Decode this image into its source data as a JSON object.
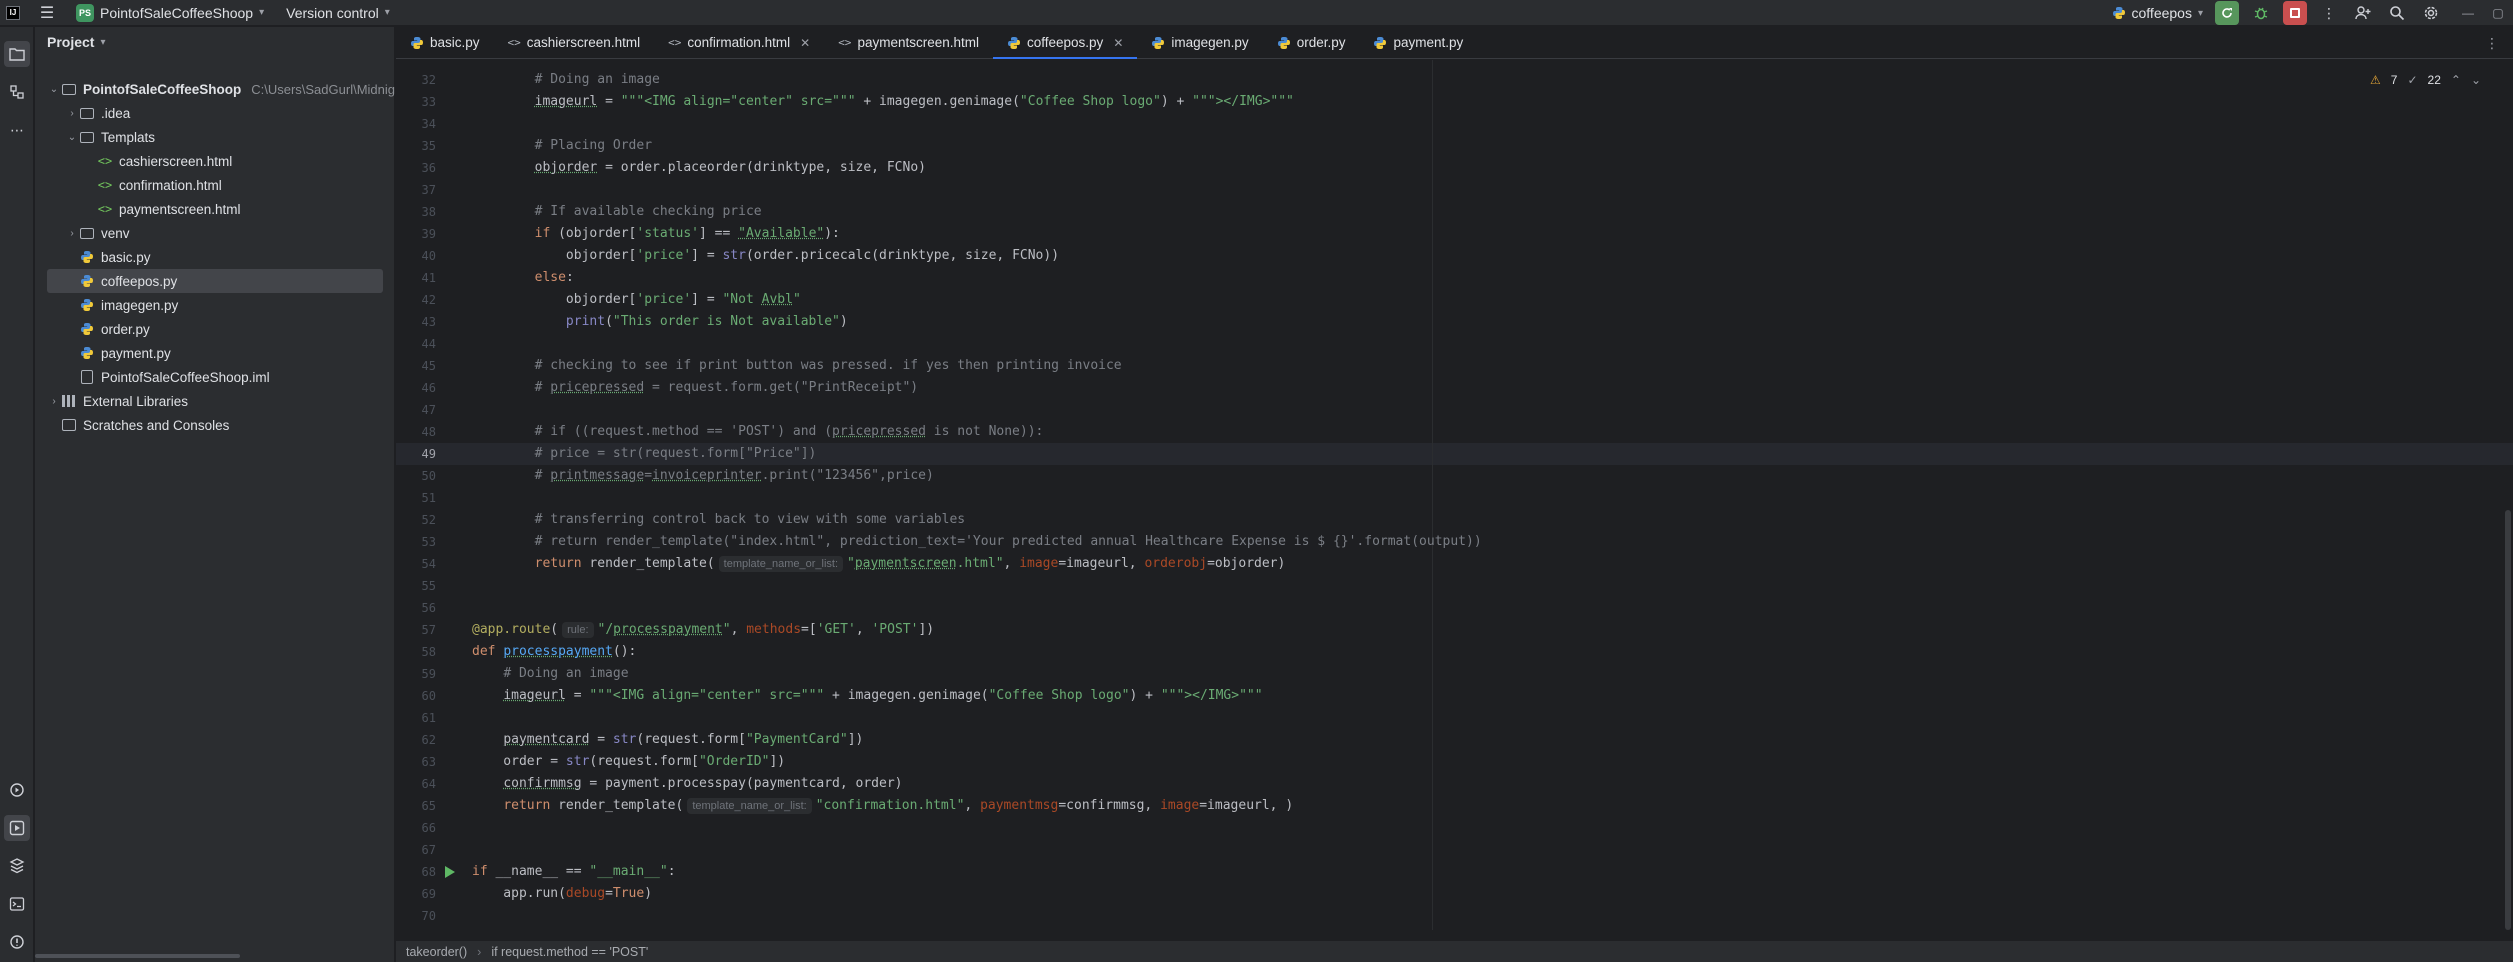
{
  "titlebar": {
    "logo_text": "IJ",
    "project_badge": "PS",
    "project_name": "PointofSaleCoffeeShoop",
    "version_control": "Version control",
    "run_config": "coffeepos"
  },
  "project_panel": {
    "title": "Project",
    "tree": [
      {
        "label": "PointofSaleCoffeeShoop",
        "path": "C:\\Users\\SadGurl\\Midnig",
        "type": "folder",
        "depth": 0,
        "expanded": true
      },
      {
        "label": ".idea",
        "type": "folder",
        "depth": 1,
        "expanded": false
      },
      {
        "label": "Templats",
        "type": "folder",
        "depth": 1,
        "expanded": true
      },
      {
        "label": "cashierscreen.html",
        "type": "html",
        "depth": 2
      },
      {
        "label": "confirmation.html",
        "type": "html",
        "depth": 2
      },
      {
        "label": "paymentscreen.html",
        "type": "html",
        "depth": 2
      },
      {
        "label": "venv",
        "type": "folder",
        "depth": 1,
        "expanded": false
      },
      {
        "label": "basic.py",
        "type": "py",
        "depth": 1
      },
      {
        "label": "coffeepos.py",
        "type": "py",
        "depth": 1,
        "selected": true
      },
      {
        "label": "imagegen.py",
        "type": "py",
        "depth": 1
      },
      {
        "label": "order.py",
        "type": "py",
        "depth": 1
      },
      {
        "label": "payment.py",
        "type": "py",
        "depth": 1
      },
      {
        "label": "PointofSaleCoffeeShoop.iml",
        "type": "iml",
        "depth": 1
      },
      {
        "label": "External Libraries",
        "type": "lib",
        "depth": 0,
        "expanded": false
      },
      {
        "label": "Scratches and Consoles",
        "type": "scratch",
        "depth": 0
      }
    ]
  },
  "tabs": [
    {
      "label": "basic.py",
      "type": "py"
    },
    {
      "label": "cashierscreen.html",
      "type": "html"
    },
    {
      "label": "confirmation.html",
      "type": "html",
      "closable": true
    },
    {
      "label": "paymentscreen.html",
      "type": "html"
    },
    {
      "label": "coffeepos.py",
      "type": "py",
      "active": true,
      "closable": true
    },
    {
      "label": "imagegen.py",
      "type": "py"
    },
    {
      "label": "order.py",
      "type": "py"
    },
    {
      "label": "payment.py",
      "type": "py"
    }
  ],
  "inspections": {
    "warnings": "7",
    "weak_warnings": "22"
  },
  "code": {
    "current_line": 49,
    "lines": [
      {
        "n": "32",
        "html": "        <span class=\"c-cm\"># Doing an image</span>"
      },
      {
        "n": "33",
        "html": "        <span class=\"uline\">imageurl</span> = <span class=\"c-st\">\"\"\"&lt;IMG align=\"center\" src=\"\"\"</span> + imagegen.genimage(<span class=\"c-st\">\"Coffee Shop logo\"</span>) + <span class=\"c-st\">\"\"\"&gt;&lt;/IMG&gt;\"\"\"</span>"
      },
      {
        "n": "34",
        "html": ""
      },
      {
        "n": "35",
        "html": "        <span class=\"c-cm\"># Placing Order</span>"
      },
      {
        "n": "36",
        "html": "        <span class=\"uline\">objorder</span> = order.placeorder(drinktype, size, FCNo)"
      },
      {
        "n": "37",
        "html": ""
      },
      {
        "n": "38",
        "html": "        <span class=\"c-cm\"># If available checking price</span>"
      },
      {
        "n": "39",
        "html": "        <span class=\"c-kw\">if</span> (objorder[<span class=\"c-st\">'status'</span>] == <span class=\"c-st uline\">\"Available\"</span>):"
      },
      {
        "n": "40",
        "html": "            objorder[<span class=\"c-st\">'price'</span>] = <span class=\"c-bi\">str</span>(order.pricecalc(drinktype, size, FCNo))"
      },
      {
        "n": "41",
        "html": "        <span class=\"c-kw\">else</span>:"
      },
      {
        "n": "42",
        "html": "            objorder[<span class=\"c-st\">'price'</span>] = <span class=\"c-st\">\"Not <span class=\"uline\">Avbl</span>\"</span>"
      },
      {
        "n": "43",
        "html": "            <span class=\"c-bi\">print</span>(<span class=\"c-st\">\"This order is Not available\"</span>)"
      },
      {
        "n": "44",
        "html": ""
      },
      {
        "n": "45",
        "html": "        <span class=\"c-cm\"># checking to see if print button was pressed. if yes then printing invoice</span>"
      },
      {
        "n": "46",
        "html": "        <span class=\"c-cm\"># <span class=\"uline\">pricepressed</span> = request.form.get(\"PrintReceipt\")</span>"
      },
      {
        "n": "47",
        "html": ""
      },
      {
        "n": "48",
        "html": "        <span class=\"c-cm\"># if ((request.method == 'POST') and (<span class=\"uline\">pricepressed</span> is not None)):</span>"
      },
      {
        "n": "49",
        "html": "        <span class=\"c-cm\"># price = str(request.form[\"Price\"])</span>"
      },
      {
        "n": "50",
        "html": "        <span class=\"c-cm\"># <span class=\"uline\">printmessage</span>=<span class=\"uline\">invoiceprinter</span>.print(\"123456\",price)</span>"
      },
      {
        "n": "51",
        "html": ""
      },
      {
        "n": "52",
        "html": "        <span class=\"c-cm\"># transferring control back to view with some variables</span>"
      },
      {
        "n": "53",
        "html": "        <span class=\"c-cm\"># return render_template(\"index.html\", prediction_text='Your predicted annual Healthcare Expense is $ {}'.format(output))</span>"
      },
      {
        "n": "54",
        "html": "        <span class=\"c-kw\">return</span> render_template(<span class=\"hint\">template_name_or_list:</span><span class=\"c-st\">\"<span class=\"uline\">paymentscreen</span>.html\"</span>, <span class=\"c-pa\">image</span>=imageurl, <span class=\"c-pa\">orderobj</span>=objorder)"
      },
      {
        "n": "55",
        "html": ""
      },
      {
        "n": "56",
        "html": ""
      },
      {
        "n": "57",
        "html": "<span class=\"c-dec\">@app.route</span>(<span class=\"hint\">rule:</span><span class=\"c-st\">\"/<span class=\"uline\">processpayment</span>\"</span>, <span class=\"c-pa\">methods</span>=[<span class=\"c-st\">'GET'</span>, <span class=\"c-st\">'POST'</span>])"
      },
      {
        "n": "58",
        "html": "<span class=\"c-kw\">def</span> <span class=\"c-fn uline\">processpayment</span>():"
      },
      {
        "n": "59",
        "html": "    <span class=\"c-cm\"># Doing an image</span>"
      },
      {
        "n": "60",
        "html": "    <span class=\"uline\">imageurl</span> = <span class=\"c-st\">\"\"\"&lt;IMG align=\"center\" src=\"\"\"</span> + imagegen.genimage(<span class=\"c-st\">\"Coffee Shop logo\"</span>) + <span class=\"c-st\">\"\"\"&gt;&lt;/IMG&gt;\"\"\"</span>"
      },
      {
        "n": "61",
        "html": ""
      },
      {
        "n": "62",
        "html": "    <span class=\"uline\">paymentcard</span> = <span class=\"c-bi\">str</span>(request.form[<span class=\"c-st\">\"PaymentCard\"</span>])"
      },
      {
        "n": "63",
        "html": "    order = <span class=\"c-bi\">str</span>(request.form[<span class=\"c-st\">\"OrderID\"</span>])"
      },
      {
        "n": "64",
        "html": "    <span class=\"uline\">confirmmsg</span> = payment.processpay(paymentcard, order)"
      },
      {
        "n": "65",
        "html": "    <span class=\"c-kw\">return</span> render_template(<span class=\"hint\">template_name_or_list:</span><span class=\"c-st\">\"confirmation.html\"</span>, <span class=\"c-pa\">paymentmsg</span>=confirmmsg, <span class=\"c-pa\">image</span>=imageurl, )"
      },
      {
        "n": "66",
        "html": ""
      },
      {
        "n": "67",
        "html": ""
      },
      {
        "n": "68",
        "html": "<span class=\"c-kw\">if</span> __name__ == <span class=\"c-st\">\"__main__\"</span>:",
        "run": true
      },
      {
        "n": "69",
        "html": "    app.run(<span class=\"c-pa\">debug</span>=<span class=\"c-kw\">True</span>)"
      },
      {
        "n": "70",
        "html": ""
      }
    ]
  },
  "statusbar": {
    "crumb1": "takeorder()",
    "crumb2": "if request.method == 'POST'"
  },
  "colors": {
    "accent": "#3574f0",
    "run_green": "#57965c",
    "stop_red": "#c94f4f"
  }
}
